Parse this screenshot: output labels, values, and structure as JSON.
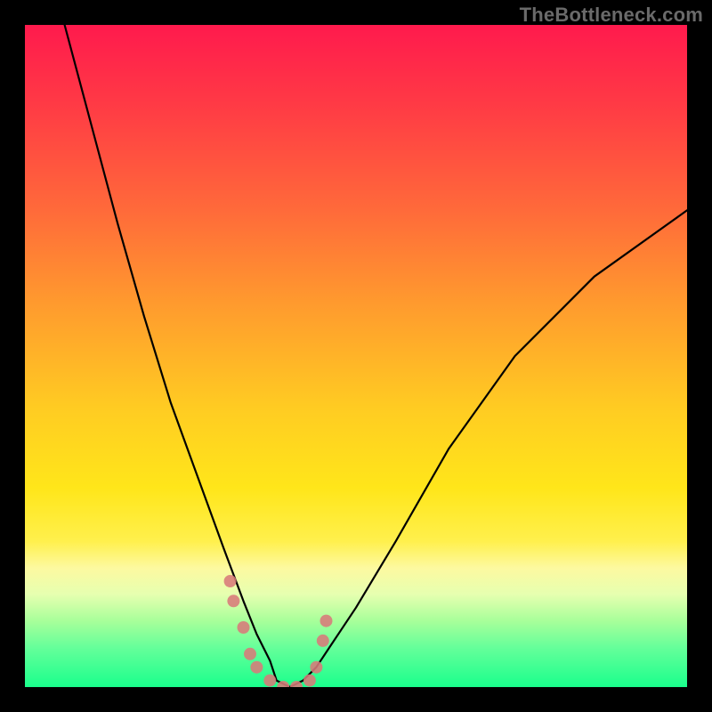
{
  "watermark": "TheBottleneck.com",
  "chart_data": {
    "type": "line",
    "title": "",
    "xlabel": "",
    "ylabel": "",
    "xlim": [
      0,
      100
    ],
    "ylim": [
      0,
      100
    ],
    "grid": false,
    "legend": false,
    "background_gradient": {
      "direction": "vertical",
      "stops": [
        {
          "pos": 0.0,
          "color": "#ff1a4d"
        },
        {
          "pos": 0.12,
          "color": "#ff3a45"
        },
        {
          "pos": 0.28,
          "color": "#ff6a3a"
        },
        {
          "pos": 0.42,
          "color": "#ff9a2e"
        },
        {
          "pos": 0.58,
          "color": "#ffcc22"
        },
        {
          "pos": 0.7,
          "color": "#ffe61a"
        },
        {
          "pos": 0.78,
          "color": "#fff04d"
        },
        {
          "pos": 0.82,
          "color": "#fdf9a0"
        },
        {
          "pos": 0.86,
          "color": "#e6ffb0"
        },
        {
          "pos": 0.9,
          "color": "#a8ff9a"
        },
        {
          "pos": 0.94,
          "color": "#66ff9a"
        },
        {
          "pos": 1.0,
          "color": "#1aff8c"
        }
      ]
    },
    "notes": "V-shaped bottleneck curve; y is bottleneck percentage (100 at top, 0 at bottom). Minimum near x≈38–42. Salmon-colored markers cluster near the bottom of the V.",
    "series": [
      {
        "name": "curve",
        "style": "line",
        "color": "#000000",
        "x": [
          6,
          10,
          14,
          18,
          22,
          26,
          30,
          33,
          35,
          37,
          38,
          40,
          42,
          44,
          46,
          50,
          56,
          64,
          74,
          86,
          100
        ],
        "values": [
          100,
          85,
          70,
          56,
          43,
          32,
          21,
          13,
          8,
          4,
          1,
          0,
          1,
          3,
          6,
          12,
          22,
          36,
          50,
          62,
          72
        ]
      },
      {
        "name": "points",
        "style": "scatter",
        "color": "#d87a7a",
        "marker_radius": 7,
        "x": [
          31,
          31.5,
          33,
          34,
          35,
          37,
          39,
          41,
          43,
          44,
          45,
          45.5
        ],
        "values": [
          16,
          13,
          9,
          5,
          3,
          1,
          0,
          0,
          1,
          3,
          7,
          10
        ]
      }
    ]
  },
  "colors": {
    "curve": "#000000",
    "markers": "#d87a7a",
    "frame": "#000000",
    "watermark": "#6a6a6a"
  }
}
